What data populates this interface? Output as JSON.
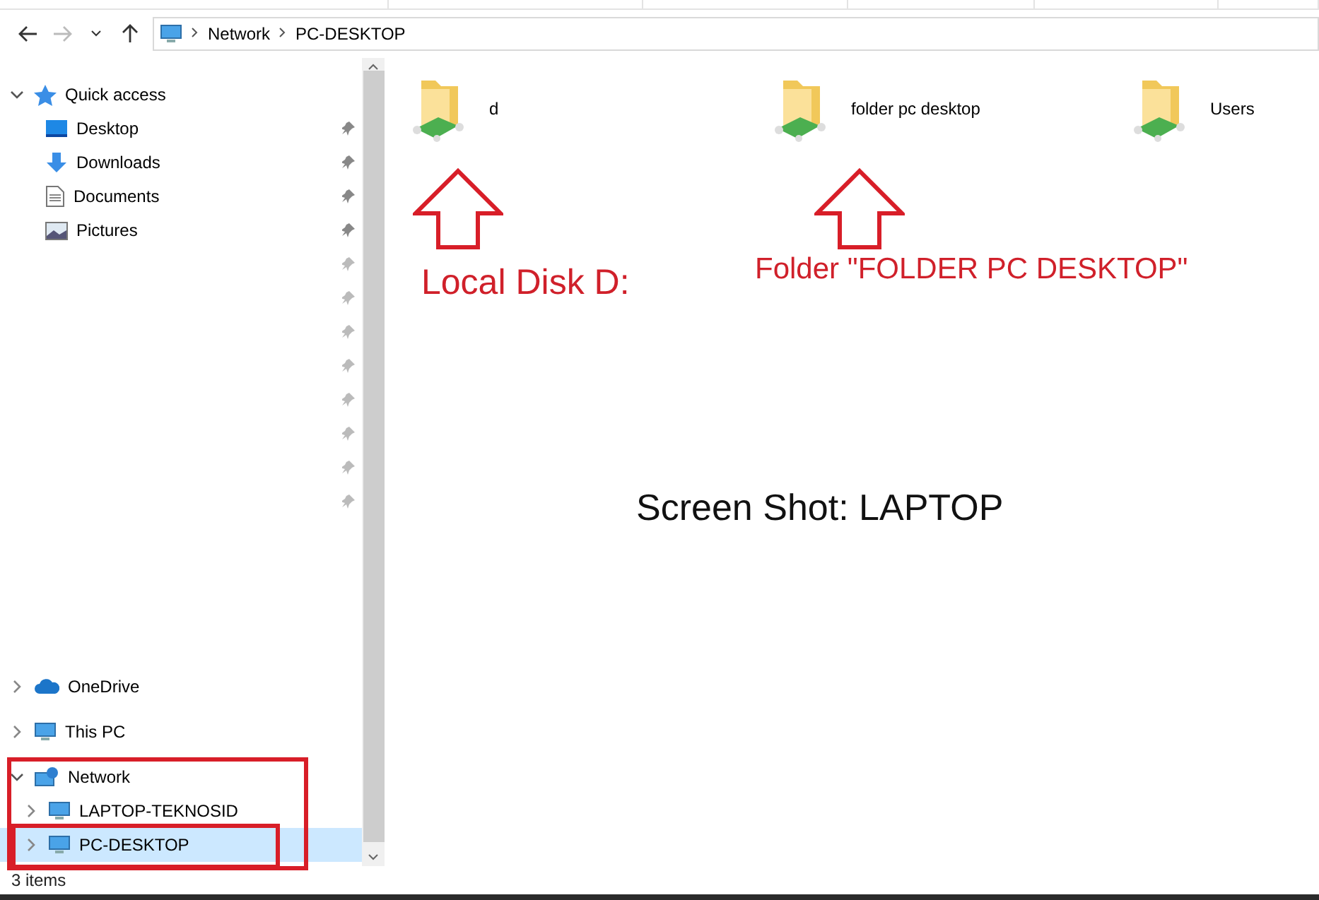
{
  "nav": {
    "back_enabled": true,
    "forward_enabled": false
  },
  "breadcrumb": [
    "Network",
    "PC-DESKTOP"
  ],
  "quick_access": {
    "label": "Quick access",
    "expanded": true,
    "items": [
      {
        "label": "Desktop",
        "kind": "desktop",
        "pinned": true
      },
      {
        "label": "Downloads",
        "kind": "downloads",
        "pinned": true
      },
      {
        "label": "Documents",
        "kind": "documents",
        "pinned": true
      },
      {
        "label": "Pictures",
        "kind": "pictures",
        "pinned": true
      }
    ]
  },
  "tree": [
    {
      "label": "OneDrive",
      "kind": "cloud",
      "expanded": false,
      "selected": false
    },
    {
      "label": "This PC",
      "kind": "computer",
      "expanded": false,
      "selected": false
    },
    {
      "label": "Network",
      "kind": "network",
      "expanded": true,
      "selected": false,
      "children": [
        {
          "label": "LAPTOP-TEKNOSID",
          "kind": "computer",
          "expanded": false,
          "selected": false
        },
        {
          "label": "PC-DESKTOP",
          "kind": "computer",
          "expanded": false,
          "selected": true
        }
      ]
    }
  ],
  "files": [
    {
      "name": "d"
    },
    {
      "name": "folder pc desktop"
    },
    {
      "name": "Users"
    }
  ],
  "annotations": {
    "labels": [
      "Local Disk D:",
      "Folder \"FOLDER PC DESKTOP\""
    ],
    "caption": "Screen Shot: LAPTOP"
  },
  "status_bar": "3 items"
}
